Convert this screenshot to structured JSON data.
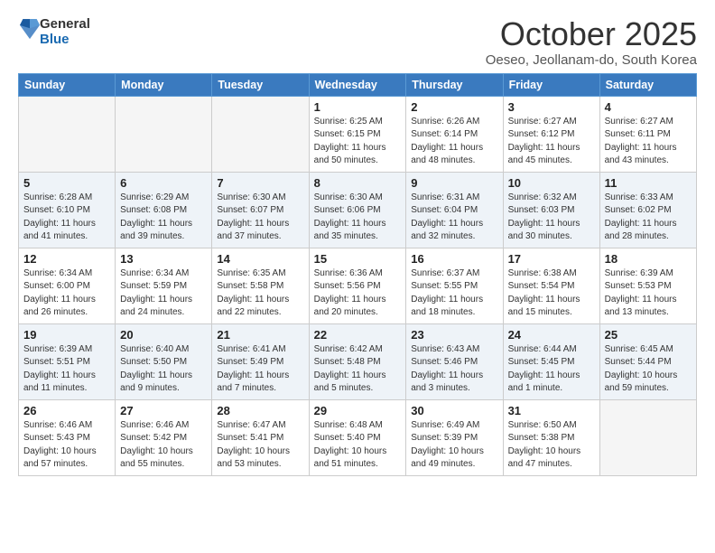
{
  "header": {
    "logo_general": "General",
    "logo_blue": "Blue",
    "month_title": "October 2025",
    "location": "Oeseo, Jeollanam-do, South Korea"
  },
  "days_of_week": [
    "Sunday",
    "Monday",
    "Tuesday",
    "Wednesday",
    "Thursday",
    "Friday",
    "Saturday"
  ],
  "weeks": [
    [
      {
        "day": "",
        "text": ""
      },
      {
        "day": "",
        "text": ""
      },
      {
        "day": "",
        "text": ""
      },
      {
        "day": "1",
        "text": "Sunrise: 6:25 AM\nSunset: 6:15 PM\nDaylight: 11 hours\nand 50 minutes."
      },
      {
        "day": "2",
        "text": "Sunrise: 6:26 AM\nSunset: 6:14 PM\nDaylight: 11 hours\nand 48 minutes."
      },
      {
        "day": "3",
        "text": "Sunrise: 6:27 AM\nSunset: 6:12 PM\nDaylight: 11 hours\nand 45 minutes."
      },
      {
        "day": "4",
        "text": "Sunrise: 6:27 AM\nSunset: 6:11 PM\nDaylight: 11 hours\nand 43 minutes."
      }
    ],
    [
      {
        "day": "5",
        "text": "Sunrise: 6:28 AM\nSunset: 6:10 PM\nDaylight: 11 hours\nand 41 minutes."
      },
      {
        "day": "6",
        "text": "Sunrise: 6:29 AM\nSunset: 6:08 PM\nDaylight: 11 hours\nand 39 minutes."
      },
      {
        "day": "7",
        "text": "Sunrise: 6:30 AM\nSunset: 6:07 PM\nDaylight: 11 hours\nand 37 minutes."
      },
      {
        "day": "8",
        "text": "Sunrise: 6:30 AM\nSunset: 6:06 PM\nDaylight: 11 hours\nand 35 minutes."
      },
      {
        "day": "9",
        "text": "Sunrise: 6:31 AM\nSunset: 6:04 PM\nDaylight: 11 hours\nand 32 minutes."
      },
      {
        "day": "10",
        "text": "Sunrise: 6:32 AM\nSunset: 6:03 PM\nDaylight: 11 hours\nand 30 minutes."
      },
      {
        "day": "11",
        "text": "Sunrise: 6:33 AM\nSunset: 6:02 PM\nDaylight: 11 hours\nand 28 minutes."
      }
    ],
    [
      {
        "day": "12",
        "text": "Sunrise: 6:34 AM\nSunset: 6:00 PM\nDaylight: 11 hours\nand 26 minutes."
      },
      {
        "day": "13",
        "text": "Sunrise: 6:34 AM\nSunset: 5:59 PM\nDaylight: 11 hours\nand 24 minutes."
      },
      {
        "day": "14",
        "text": "Sunrise: 6:35 AM\nSunset: 5:58 PM\nDaylight: 11 hours\nand 22 minutes."
      },
      {
        "day": "15",
        "text": "Sunrise: 6:36 AM\nSunset: 5:56 PM\nDaylight: 11 hours\nand 20 minutes."
      },
      {
        "day": "16",
        "text": "Sunrise: 6:37 AM\nSunset: 5:55 PM\nDaylight: 11 hours\nand 18 minutes."
      },
      {
        "day": "17",
        "text": "Sunrise: 6:38 AM\nSunset: 5:54 PM\nDaylight: 11 hours\nand 15 minutes."
      },
      {
        "day": "18",
        "text": "Sunrise: 6:39 AM\nSunset: 5:53 PM\nDaylight: 11 hours\nand 13 minutes."
      }
    ],
    [
      {
        "day": "19",
        "text": "Sunrise: 6:39 AM\nSunset: 5:51 PM\nDaylight: 11 hours\nand 11 minutes."
      },
      {
        "day": "20",
        "text": "Sunrise: 6:40 AM\nSunset: 5:50 PM\nDaylight: 11 hours\nand 9 minutes."
      },
      {
        "day": "21",
        "text": "Sunrise: 6:41 AM\nSunset: 5:49 PM\nDaylight: 11 hours\nand 7 minutes."
      },
      {
        "day": "22",
        "text": "Sunrise: 6:42 AM\nSunset: 5:48 PM\nDaylight: 11 hours\nand 5 minutes."
      },
      {
        "day": "23",
        "text": "Sunrise: 6:43 AM\nSunset: 5:46 PM\nDaylight: 11 hours\nand 3 minutes."
      },
      {
        "day": "24",
        "text": "Sunrise: 6:44 AM\nSunset: 5:45 PM\nDaylight: 11 hours\nand 1 minute."
      },
      {
        "day": "25",
        "text": "Sunrise: 6:45 AM\nSunset: 5:44 PM\nDaylight: 10 hours\nand 59 minutes."
      }
    ],
    [
      {
        "day": "26",
        "text": "Sunrise: 6:46 AM\nSunset: 5:43 PM\nDaylight: 10 hours\nand 57 minutes."
      },
      {
        "day": "27",
        "text": "Sunrise: 6:46 AM\nSunset: 5:42 PM\nDaylight: 10 hours\nand 55 minutes."
      },
      {
        "day": "28",
        "text": "Sunrise: 6:47 AM\nSunset: 5:41 PM\nDaylight: 10 hours\nand 53 minutes."
      },
      {
        "day": "29",
        "text": "Sunrise: 6:48 AM\nSunset: 5:40 PM\nDaylight: 10 hours\nand 51 minutes."
      },
      {
        "day": "30",
        "text": "Sunrise: 6:49 AM\nSunset: 5:39 PM\nDaylight: 10 hours\nand 49 minutes."
      },
      {
        "day": "31",
        "text": "Sunrise: 6:50 AM\nSunset: 5:38 PM\nDaylight: 10 hours\nand 47 minutes."
      },
      {
        "day": "",
        "text": ""
      }
    ]
  ]
}
